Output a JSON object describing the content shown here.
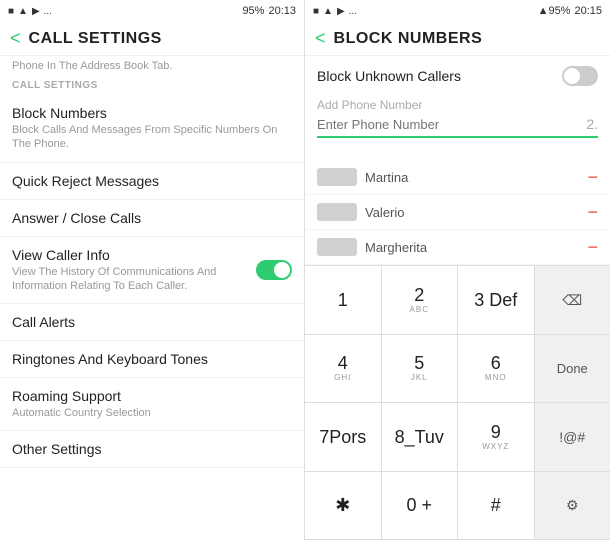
{
  "left": {
    "status": {
      "icons": "■ ▲ ▶ ...",
      "battery": "95%",
      "time": "20:13"
    },
    "header": {
      "back": "<",
      "title": "CALL SETTINGS"
    },
    "tab_hint": "Phone In The Address Book Tab.",
    "section_label": "CALL SETTINGS",
    "items": [
      {
        "title": "Block Numbers",
        "subtitle": "Block Calls And Messages From Specific Numbers On The Phone."
      },
      {
        "title": "Quick Reject Messages",
        "subtitle": ""
      },
      {
        "title": "Answer / Close Calls",
        "subtitle": ""
      },
      {
        "title": "View Caller Info",
        "subtitle": "View The History Of Communications And Information Relating To Each Caller.",
        "toggle": true,
        "toggle_on": true
      },
      {
        "title": "Call Alerts",
        "subtitle": ""
      },
      {
        "title": "Ringtones And Keyboard Tones",
        "subtitle": ""
      },
      {
        "title": "Roaming Support",
        "subtitle": "Automatic Country Selection"
      },
      {
        "title": "Other Settings",
        "subtitle": ""
      }
    ]
  },
  "right": {
    "status": {
      "icons": "■ ▲ ▶ ...",
      "signal": "▲95%",
      "time": "20:15"
    },
    "header": {
      "back": "<",
      "title": "BLOCK NUMBERS"
    },
    "block_unknown": {
      "label": "Block Unknown Callers",
      "enabled": false
    },
    "add_phone": {
      "label": "Add Phone Number",
      "placeholder": "Enter Phone Number",
      "number": "2."
    },
    "blocked_contacts": [
      {
        "name": "Martina"
      },
      {
        "name": "Valerio"
      },
      {
        "name": "Margherita"
      }
    ],
    "keyboard": {
      "rows": [
        [
          {
            "main": "1",
            "sub": ""
          },
          {
            "main": "2",
            "sub": "ABC"
          },
          {
            "main": "3 Def",
            "sub": ""
          },
          {
            "main": "⌫",
            "sub": "",
            "action": true
          }
        ],
        [
          {
            "main": "4",
            "sub": "GHI"
          },
          {
            "main": "5",
            "sub": "JKL"
          },
          {
            "main": "6",
            "sub": "MNO"
          },
          {
            "main": "Done",
            "sub": "",
            "action": true
          }
        ],
        [
          {
            "main": "7Pors",
            "sub": ""
          },
          {
            "main": "8_Tuv",
            "sub": ""
          },
          {
            "main": "9",
            "sub": "WXYZ"
          },
          {
            "main": "!@#",
            "sub": "",
            "action": true
          }
        ],
        [
          {
            "main": "✱",
            "sub": ""
          },
          {
            "main": "0 +",
            "sub": ""
          },
          {
            "main": "#",
            "sub": ""
          },
          {
            "main": "⚙",
            "sub": "",
            "action": true
          }
        ]
      ]
    }
  }
}
